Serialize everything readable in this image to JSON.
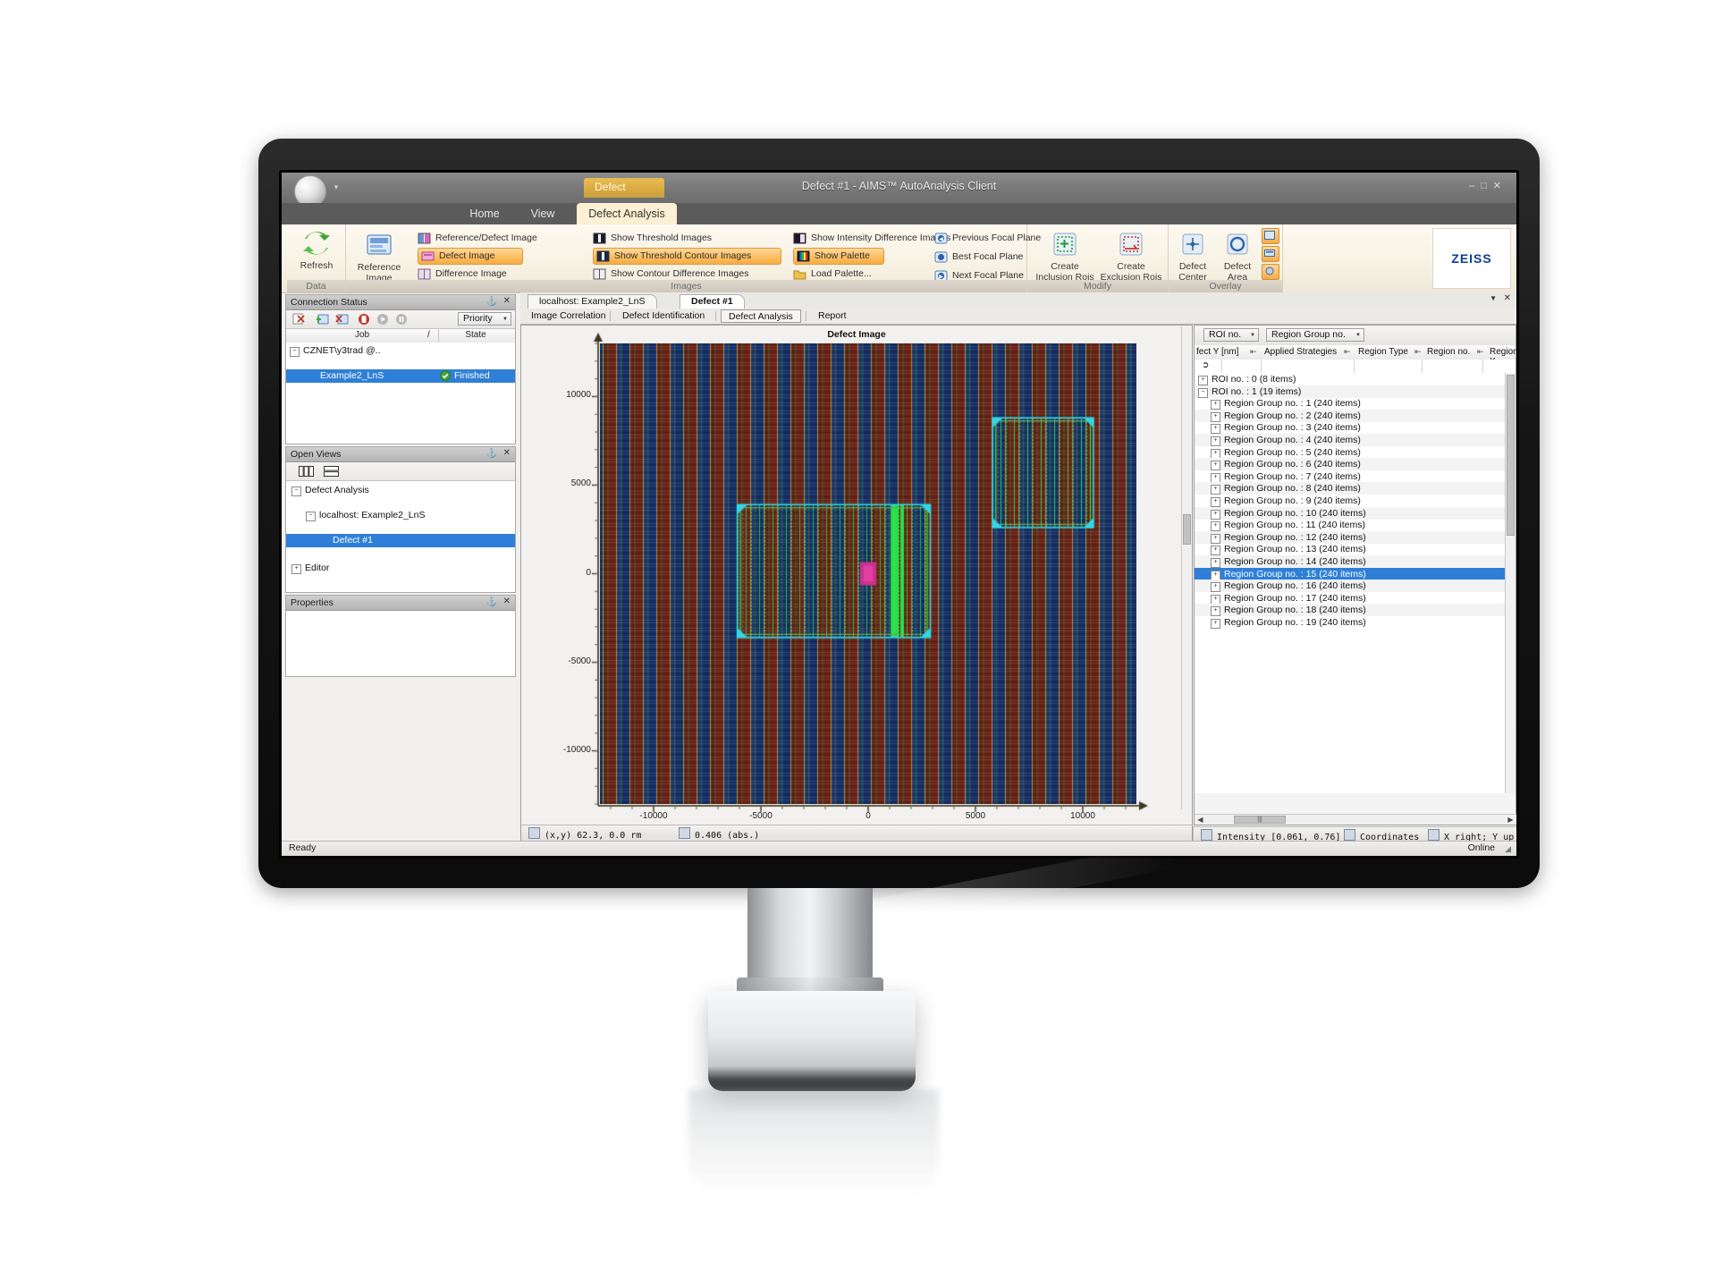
{
  "window": {
    "title": "Defect #1 - AIMS™ AutoAnalysis Client",
    "minimize": "–",
    "maximize": "□",
    "close": "✕",
    "context_tab": "Defect",
    "brand": "ZEISS"
  },
  "ribbon": {
    "tabs": [
      {
        "label": "Home",
        "active": false
      },
      {
        "label": "View",
        "active": false
      },
      {
        "label": "Defect Analysis",
        "active": true
      }
    ],
    "groups": [
      {
        "name": "Data",
        "buttons": [
          {
            "label": "Refresh",
            "icon": "refresh-icon"
          }
        ]
      },
      {
        "name": "Images",
        "buttons": [
          {
            "label": "Reference Image",
            "icon": "reference-image-icon"
          }
        ],
        "items_col1": [
          {
            "label": "Reference/Defect Image",
            "icon": "reference-defect-image-icon",
            "active": false
          },
          {
            "label": "Defect Image",
            "icon": "defect-image-icon",
            "active": true
          },
          {
            "label": "Difference Image",
            "icon": "difference-image-icon",
            "active": false
          }
        ],
        "items_col2": [
          {
            "label": "Show Threshold Images",
            "icon": "threshold-images-icon",
            "active": false
          },
          {
            "label": "Show Threshold Contour Images",
            "icon": "threshold-contour-images-icon",
            "active": true
          },
          {
            "label": "Show Contour Difference Images",
            "icon": "contour-difference-images-icon",
            "active": false
          }
        ],
        "items_col3": [
          {
            "label": "Show Intensity Difference Images",
            "icon": "intensity-difference-images-icon",
            "active": false
          },
          {
            "label": "Show Palette",
            "icon": "palette-icon",
            "active": true
          },
          {
            "label": "Load Palette...",
            "icon": "load-palette-icon",
            "active": false
          }
        ],
        "items_col4": [
          {
            "label": "Previous Focal Plane",
            "icon": "previous-focal-plane-icon",
            "active": false
          },
          {
            "label": "Best Focal Plane",
            "icon": "best-focal-plane-icon",
            "active": false
          },
          {
            "label": "Next Focal Plane",
            "icon": "next-focal-plane-icon",
            "active": false
          }
        ]
      },
      {
        "name": "Modify",
        "buttons": [
          {
            "label": "Create\nInclusion Rois",
            "icon": "create-inclusion-rois-icon"
          },
          {
            "label": "Create\nExclusion Rois",
            "icon": "create-exclusion-rois-icon"
          }
        ]
      },
      {
        "name": "Overlay",
        "buttons": [
          {
            "label": "Defect\nCenter",
            "icon": "defect-center-icon"
          },
          {
            "label": "Defect\nArea",
            "icon": "defect-area-icon"
          }
        ],
        "mini_toggles": [
          "overlay-frame-icon",
          "overlay-label-icon",
          "overlay-link-icon"
        ]
      }
    ]
  },
  "connection_status": {
    "title": "Connection Status",
    "pin": "⚓",
    "close": "✕",
    "toolbar": [
      "remove-job-icon",
      "add-connection-icon",
      "remove-connection-icon",
      "stop-icon",
      "play-icon",
      "pause-icon"
    ],
    "priority_label": "Priority",
    "columns": [
      "Job",
      "State"
    ],
    "sort_indicator": "/",
    "rows": [
      {
        "job": "CZNET\\y3trad @..",
        "state": "",
        "indent": 0,
        "expander": "−",
        "selected": false
      },
      {
        "job": "Example2_LnS",
        "state": "Finished",
        "indent": 1,
        "expander": "",
        "selected": true,
        "status_icon": "check-circle-icon"
      }
    ]
  },
  "open_views": {
    "title": "Open Views",
    "pin": "⚓",
    "close": "✕",
    "toolbar": [
      "tile-vertical-icon",
      "tile-horizontal-icon"
    ],
    "rows": [
      {
        "label": "Defect Analysis",
        "indent": 0,
        "expander": "−",
        "selected": false
      },
      {
        "label": "localhost: Example2_LnS",
        "indent": 1,
        "expander": "−",
        "selected": false
      },
      {
        "label": "Defect #1",
        "indent": 2,
        "expander": "",
        "selected": true
      },
      {
        "label": "Editor",
        "indent": 0,
        "expander": "+",
        "selected": false
      }
    ]
  },
  "properties": {
    "title": "Properties",
    "pin": "⚓",
    "close": "✕",
    "rows": []
  },
  "document": {
    "tabs": [
      {
        "label": "localhost: Example2_LnS",
        "active": false
      },
      {
        "label": "Defect #1",
        "active": true
      }
    ],
    "close": "✕",
    "pin": "▼",
    "subtabs": [
      {
        "label": "Image Correlation",
        "active": false
      },
      {
        "label": "Defect Identification",
        "active": false
      },
      {
        "label": "Defect Analysis",
        "active": true
      },
      {
        "label": "Report",
        "active": false
      }
    ]
  },
  "chart_data": {
    "type": "heatmap",
    "title": "Defect Image",
    "xlabel": "",
    "ylabel": "",
    "xlim": [
      -12500,
      12500
    ],
    "ylim": [
      -13000,
      13000
    ],
    "xticks": [
      -10000,
      -5000,
      0,
      5000,
      10000
    ],
    "xticklabels": [
      "-10000",
      "-5000",
      "0",
      "5000",
      "10000"
    ],
    "yticks": [
      -10000,
      -5000,
      0,
      5000,
      10000
    ],
    "yticklabels": [
      "-10000",
      "-5000",
      "0",
      "5000",
      "10000"
    ],
    "grid": false,
    "description": "Line-and-space aerial image: vertical stripes alternating dark blue and dark red with thin green/tan edges; two cyan ROI rectangles and green contour overlays; magenta defect blob near center.",
    "stripe_colors": [
      "#16306b",
      "#6d2318",
      "#1d3d80",
      "#5d1f14"
    ],
    "stripe_edge_colors": [
      "#7f9a4a",
      "#a98a3c"
    ],
    "roi_rects": [
      {
        "name": "roi-left",
        "x0": -6100,
        "x1": 2900,
        "y0": -3600,
        "y1": 3900,
        "color": "#2fd7e8"
      },
      {
        "name": "roi-right",
        "x0": 5800,
        "x1": 10500,
        "y0": 2600,
        "y1": 8800,
        "color": "#2fd7e8"
      }
    ],
    "defect_marker": {
      "x": 0,
      "y": 0,
      "color": "#cc2f8e"
    },
    "contour_color": "#27d34a"
  },
  "plot_status": {
    "coordinates": "(x,y) 62.3, 0.0 rm",
    "coordinates_icon": "cursor-position-icon",
    "abs_value": "0.406 (abs.)",
    "abs_icon": "contrast-icon",
    "intensity": "Intensity [0.061, 0.76]",
    "intensity_icon": "intensity-icon",
    "coordinates_label": "Coordinates",
    "coordinates_label_icon": "coordinate-system-icon",
    "orientation": "X right; Y up (identity)",
    "orientation_icon": "orientation-icon"
  },
  "region_panel": {
    "filters": [
      {
        "label": "ROI no.",
        "name": "roi-no-filter"
      },
      {
        "label": "Region Group no.",
        "name": "region-group-no-filter"
      }
    ],
    "columns": [
      "fect Y [nm]",
      "Applied Strategies",
      "Region Type",
      "Region no.",
      "Region X"
    ],
    "filter_row_icon": "filter-icon",
    "rows": [
      {
        "label": "ROI no. : 0 (8 items)",
        "indent": 0,
        "expander": "+",
        "selected": false
      },
      {
        "label": "ROI no. : 1 (19 items)",
        "indent": 0,
        "expander": "−",
        "selected": false
      },
      {
        "label": "Region Group no. : 1 (240 items)",
        "indent": 1,
        "expander": "+",
        "selected": false
      },
      {
        "label": "Region Group no. : 2 (240 items)",
        "indent": 1,
        "expander": "+",
        "selected": false
      },
      {
        "label": "Region Group no. : 3 (240 items)",
        "indent": 1,
        "expander": "+",
        "selected": false
      },
      {
        "label": "Region Group no. : 4 (240 items)",
        "indent": 1,
        "expander": "+",
        "selected": false
      },
      {
        "label": "Region Group no. : 5 (240 items)",
        "indent": 1,
        "expander": "+",
        "selected": false
      },
      {
        "label": "Region Group no. : 6 (240 items)",
        "indent": 1,
        "expander": "+",
        "selected": false
      },
      {
        "label": "Region Group no. : 7 (240 items)",
        "indent": 1,
        "expander": "+",
        "selected": false
      },
      {
        "label": "Region Group no. : 8 (240 items)",
        "indent": 1,
        "expander": "+",
        "selected": false
      },
      {
        "label": "Region Group no. : 9 (240 items)",
        "indent": 1,
        "expander": "+",
        "selected": false
      },
      {
        "label": "Region Group no. : 10 (240 items)",
        "indent": 1,
        "expander": "+",
        "selected": false
      },
      {
        "label": "Region Group no. : 11 (240 items)",
        "indent": 1,
        "expander": "+",
        "selected": false
      },
      {
        "label": "Region Group no. : 12 (240 items)",
        "indent": 1,
        "expander": "+",
        "selected": false
      },
      {
        "label": "Region Group no. : 13 (240 items)",
        "indent": 1,
        "expander": "+",
        "selected": false
      },
      {
        "label": "Region Group no. : 14 (240 items)",
        "indent": 1,
        "expander": "+",
        "selected": false
      },
      {
        "label": "Region Group no. : 15 (240 items)",
        "indent": 1,
        "expander": "+",
        "selected": true
      },
      {
        "label": "Region Group no. : 16 (240 items)",
        "indent": 1,
        "expander": "+",
        "selected": false
      },
      {
        "label": "Region Group no. : 17 (240 items)",
        "indent": 1,
        "expander": "+",
        "selected": false
      },
      {
        "label": "Region Group no. : 18 (240 items)",
        "indent": 1,
        "expander": "+",
        "selected": false
      },
      {
        "label": "Region Group no. : 19 (240 items)",
        "indent": 1,
        "expander": "+",
        "selected": false
      }
    ]
  },
  "app_status": {
    "left": "Ready",
    "right": "Online"
  }
}
